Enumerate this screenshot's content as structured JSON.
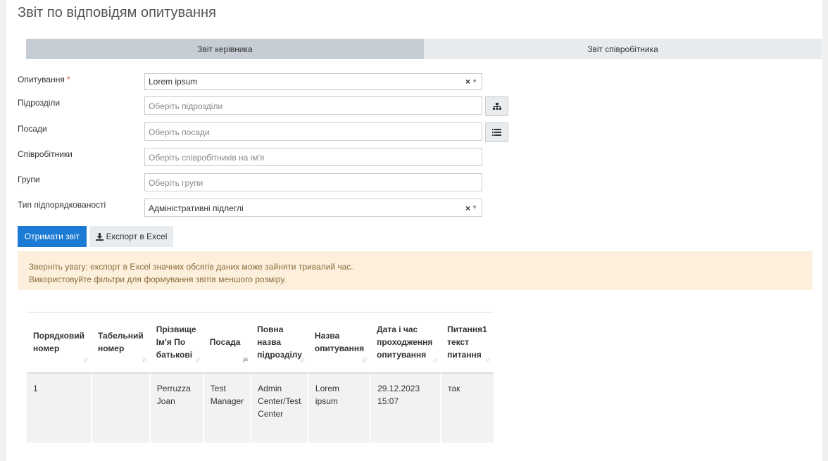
{
  "page": {
    "title": "Звіт по відповідям опитування"
  },
  "tabs": [
    {
      "label": "Звіт керівника"
    },
    {
      "label": "Звіт співробітника"
    }
  ],
  "form": {
    "survey": {
      "label": "Опитування",
      "required_mark": "*",
      "value": "Lorem ipsum"
    },
    "departments": {
      "label": "Підрозділи",
      "placeholder": "Оберіть підрозділи"
    },
    "positions": {
      "label": "Посади",
      "placeholder": "Оберіть посади"
    },
    "employees": {
      "label": "Співробітники",
      "placeholder": "Оберіть співробітників на ім'я"
    },
    "groups": {
      "label": "Групи",
      "placeholder": "Оберіть групи"
    },
    "subordination": {
      "label": "Тип підпорядкованості",
      "value": "Адміністративні підлеглі"
    }
  },
  "buttons": {
    "get_report": "Отримати звіт",
    "export_excel": "Експорт в Excel"
  },
  "alert": {
    "line1": "Зверніть увагу: експорт в Excel значних обсягів даних може зайняти тривалий час.",
    "line2": "Використовуйте фільтри для формування звітів меншого розміру."
  },
  "table": {
    "columns": [
      "Порядковий номер",
      "Табельний номер",
      "Прізвище Ім'я По батькові",
      "Посада",
      "Повна назва підрозділу",
      "Назва опитування",
      "Дата і час проходження опитування",
      "Питання1 текст питання"
    ],
    "rows": [
      [
        "1",
        "",
        "Perruzza Joan",
        "Test Manager",
        "Admin Center/Test Center",
        "Lorem ipsum",
        "29.12.2023 15:07",
        "так"
      ]
    ]
  },
  "colors": {
    "primary": "#1a7ad4",
    "tab_active": "#c6cdd4",
    "alert_bg": "#fcefdc",
    "alert_text": "#8a6d3b"
  }
}
